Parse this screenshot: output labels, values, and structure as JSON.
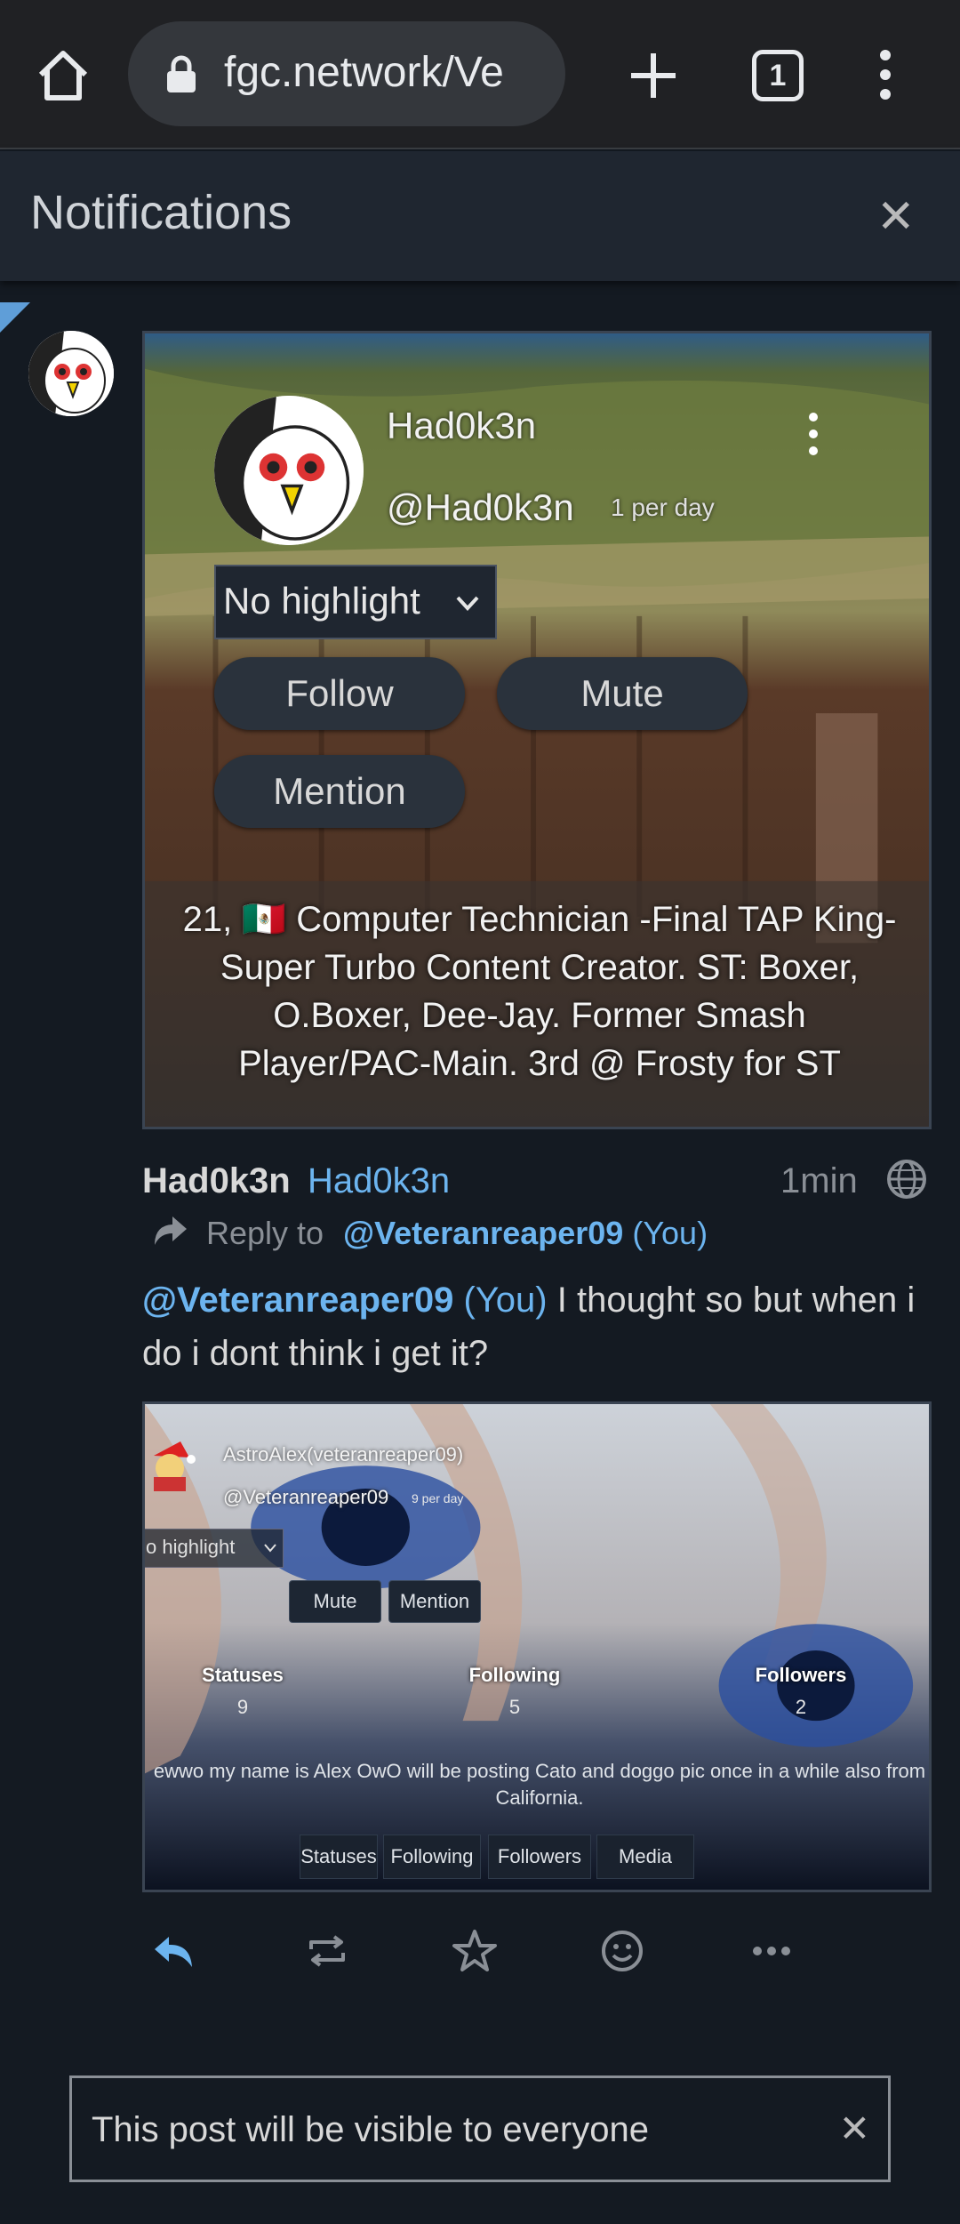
{
  "browser": {
    "url": "fgc.network/Ve",
    "tab_count": "1"
  },
  "notifications": {
    "title": "Notifications",
    "close_glyph": "✕"
  },
  "user_card": {
    "display_name": "Had0k3n",
    "handle": "@Had0k3n",
    "post_rate": "1 per day",
    "highlight_select": "No highlight",
    "follow_label": "Follow",
    "mute_label": "Mute",
    "mention_label": "Mention",
    "bio": "21, 🇲🇽 Computer Technician -Final TAP King- Super Turbo Content Creator. ST: Boxer, O.Boxer, Dee-Jay. Former Smash Player/PAC-Main. 3rd @ Frosty for ST"
  },
  "post": {
    "author_name": "Had0k3n",
    "author_account": "Had0k3n",
    "timestamp": "1min",
    "reply_to_label": "Reply to",
    "reply_target": "@Veteranreaper09",
    "reply_target_you": "(You)",
    "mention": "@Veteranreaper09",
    "mention_you": "(You)",
    "body": "I thought so but when i do i dont think i get it?"
  },
  "attachment": {
    "name": "AstroAlex(veteranreaper09)",
    "handle": "@Veteranreaper09",
    "rate": "9 per day",
    "select": "o highlight",
    "mute": "Mute",
    "mention": "Mention",
    "stats": [
      {
        "label": "Statuses",
        "value": "9"
      },
      {
        "label": "Following",
        "value": "5"
      },
      {
        "label": "Followers",
        "value": "2"
      }
    ],
    "bio": "ewwo my name is Alex OwO will be posting Cato and doggo pic once in a while also from California.",
    "tabs": [
      "Statuses",
      "Following",
      "Followers",
      "Media"
    ]
  },
  "actions": [
    "reply-icon",
    "repeat-icon",
    "favorite-icon",
    "react-icon",
    "more-icon"
  ],
  "notice": {
    "text": "This post will be visible to everyone",
    "close_glyph": "✕"
  },
  "colors": {
    "background": "#141a22",
    "link": "#6cb4ef",
    "panel": "#1f2630"
  }
}
